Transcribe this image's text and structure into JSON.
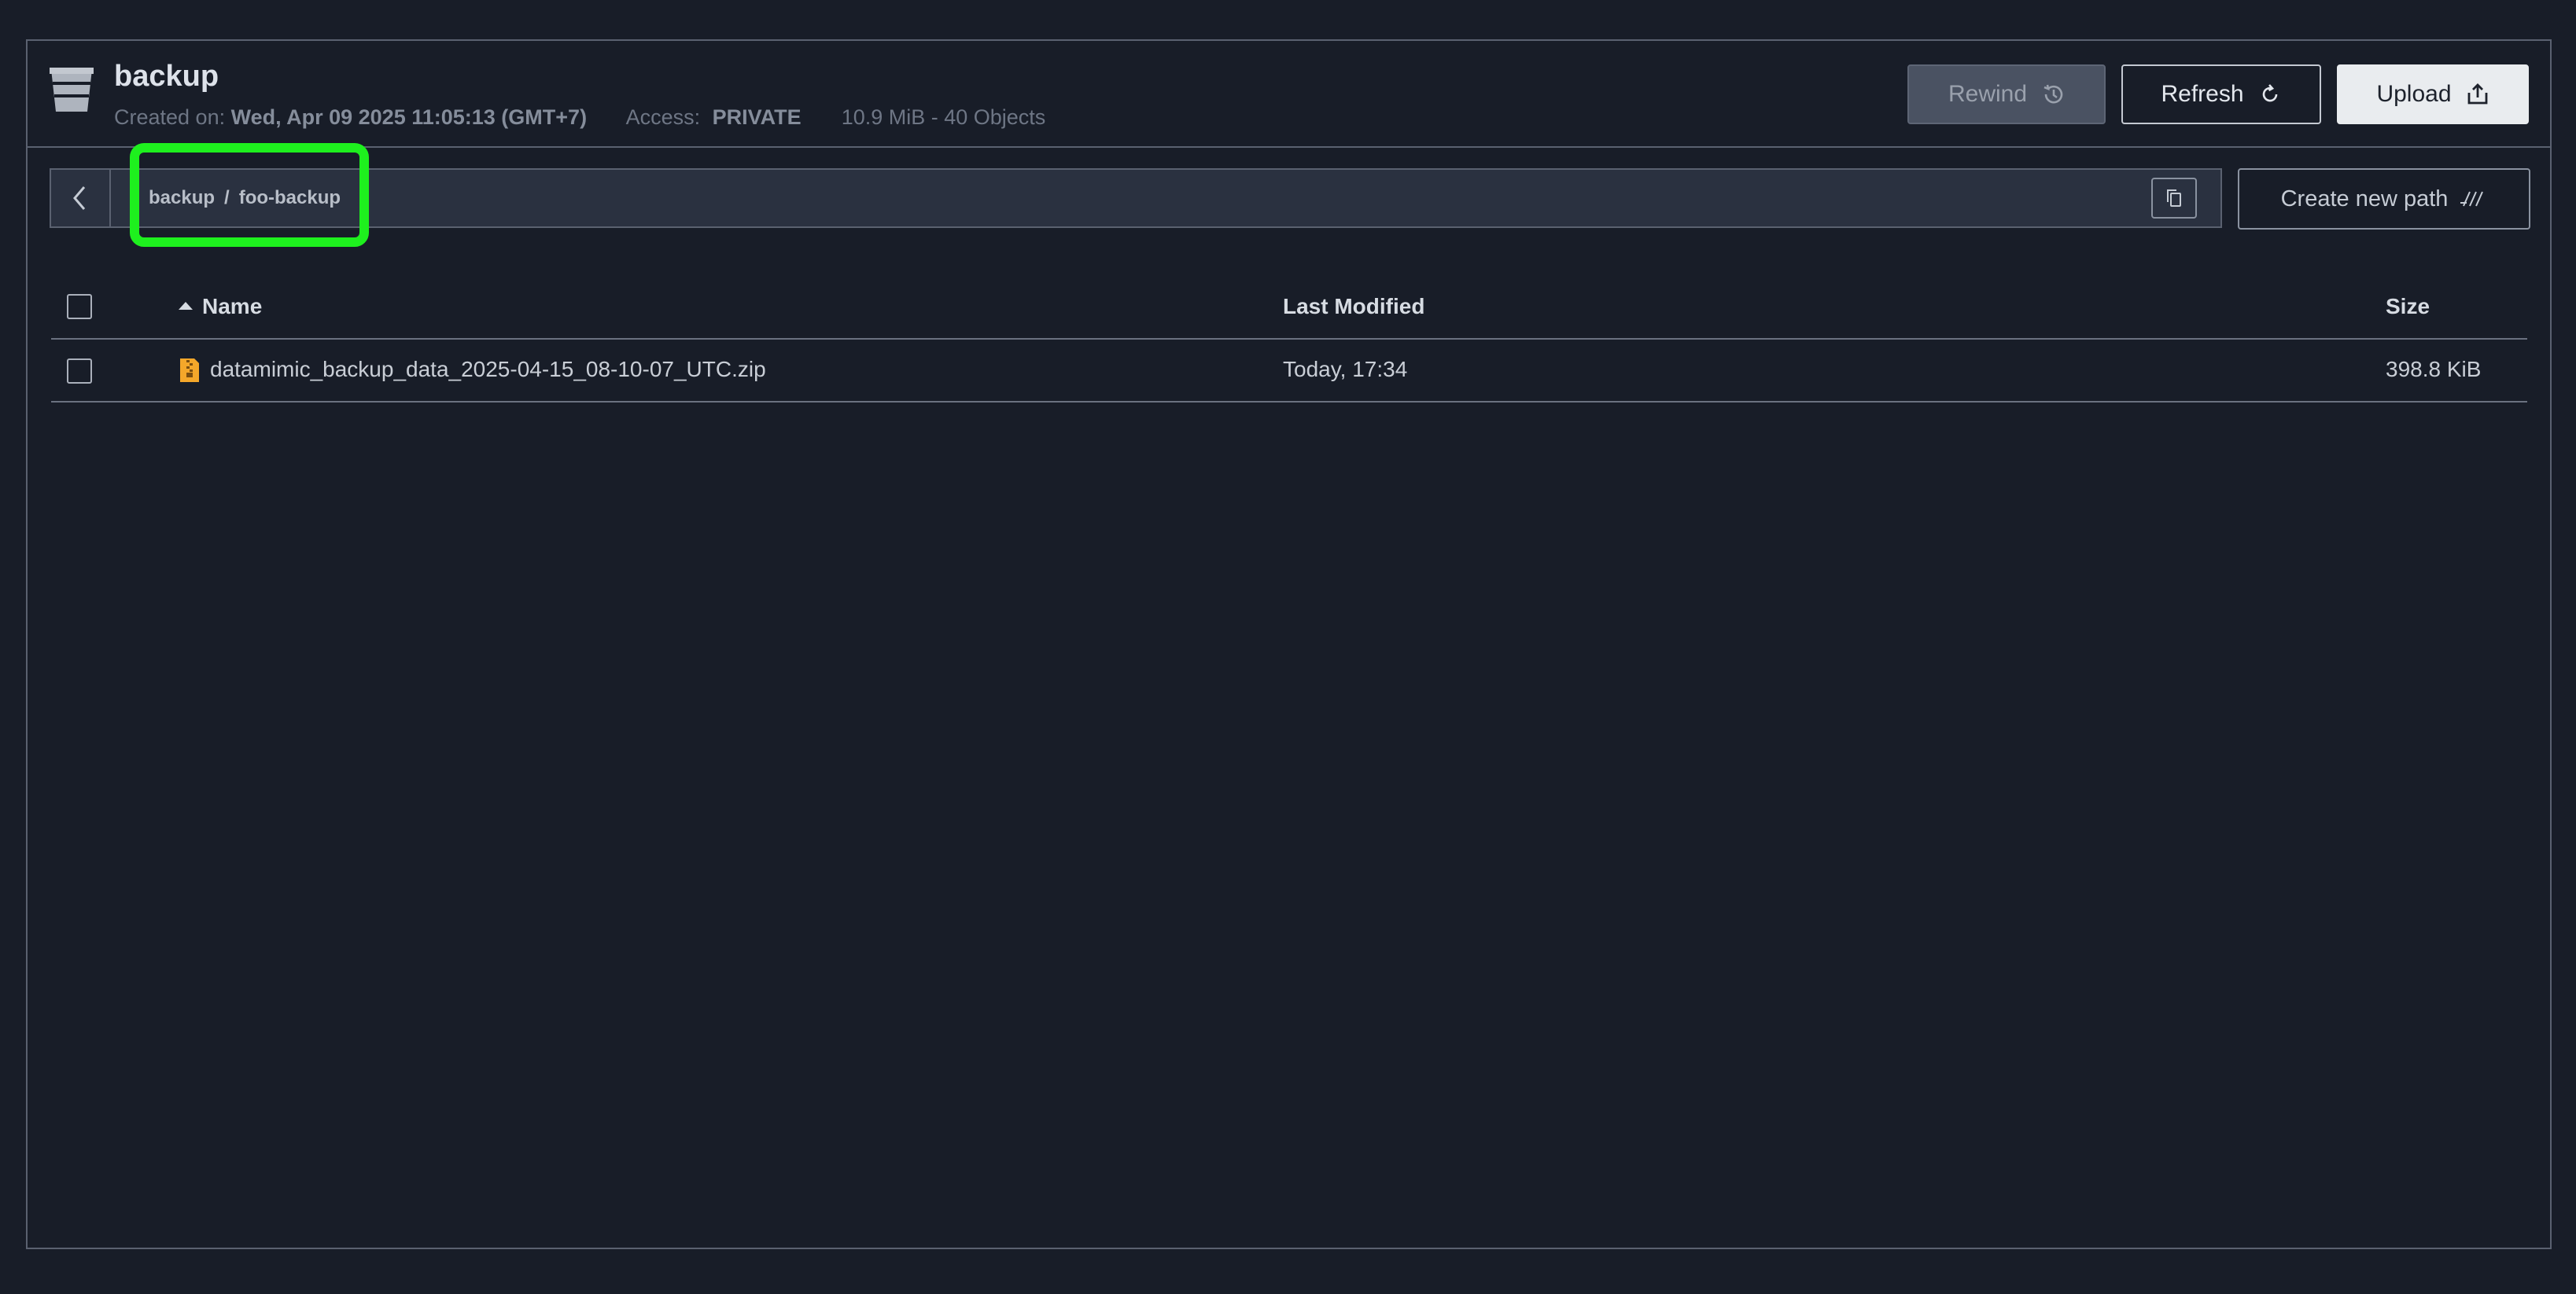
{
  "bucket": {
    "name": "backup",
    "created_label": "Created on:",
    "created_value": "Wed, Apr 09 2025 11:05:13 (GMT+7)",
    "access_label": "Access:",
    "access_value": "PRIVATE",
    "usage": "10.9 MiB - 40 Objects"
  },
  "toolbar": {
    "rewind_label": "Rewind",
    "refresh_label": "Refresh",
    "upload_label": "Upload",
    "create_path_label": "Create new path"
  },
  "path": {
    "segments": [
      "backup",
      "foo-backup"
    ],
    "separator": "/"
  },
  "table": {
    "columns": {
      "name": "Name",
      "last_modified": "Last Modified",
      "size": "Size"
    },
    "rows": [
      {
        "name": "datamimic_backup_data_2025-04-15_08-10-07_UTC.zip",
        "last_modified": "Today, 17:34",
        "size": "398.8 KiB",
        "icon": "zip-file-icon"
      }
    ]
  },
  "colors": {
    "background": "#181d28",
    "highlight": "#1ef01e",
    "zip_icon": "#f4a72a"
  }
}
